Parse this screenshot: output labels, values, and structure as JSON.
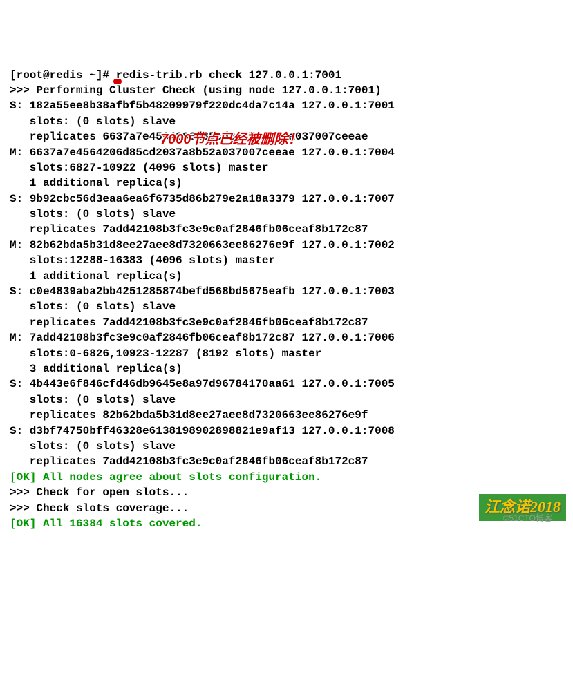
{
  "prompt_user": "root",
  "prompt_host": "redis",
  "prompt_path": "~",
  "prompt_symbol": "#",
  "command": "redis-trib.rb check 127.0.0.1:7001",
  "header": ">>> Performing Cluster Check (using node 127.0.0.1:7001)",
  "annotation_text": "7000节点已经被删除！",
  "nodes": [
    {
      "prefix": "S:",
      "id": "182a55ee8b38afbf5b48209979f220dc4da7c14a",
      "addr": "127.0.0.1:7001",
      "slots": "slots: (0 slots) slave",
      "extra": "replicates 6637a7e4564206d85cd2037a8b52a037007ceeae"
    },
    {
      "prefix": "M:",
      "id": "6637a7e4564206d85cd2037a8b52a037007ceeae",
      "addr": "127.0.0.1:7004",
      "slots": "slots:6827-10922 (4096 slots) master",
      "extra": "1 additional replica(s)"
    },
    {
      "prefix": "S:",
      "id": "9b92cbc56d3eaa6ea6f6735d86b279e2a18a3379",
      "addr": "127.0.0.1:7007",
      "slots": "slots: (0 slots) slave",
      "extra": "replicates 7add42108b3fc3e9c0af2846fb06ceaf8b172c87"
    },
    {
      "prefix": "M:",
      "id": "82b62bda5b31d8ee27aee8d7320663ee86276e9f",
      "addr": "127.0.0.1:7002",
      "slots": "slots:12288-16383 (4096 slots) master",
      "extra": "1 additional replica(s)"
    },
    {
      "prefix": "S:",
      "id": "c0e4839aba2bb4251285874befd568bd5675eafb",
      "addr": "127.0.0.1:7003",
      "slots": "slots: (0 slots) slave",
      "extra": "replicates 7add42108b3fc3e9c0af2846fb06ceaf8b172c87"
    },
    {
      "prefix": "M:",
      "id": "7add42108b3fc3e9c0af2846fb06ceaf8b172c87",
      "addr": "127.0.0.1:7006",
      "slots": "slots:0-6826,10923-12287 (8192 slots) master",
      "extra": "3 additional replica(s)"
    },
    {
      "prefix": "S:",
      "id": "4b443e6f846cfd46db9645e8a97d96784170aa61",
      "addr": "127.0.0.1:7005",
      "slots": "slots: (0 slots) slave",
      "extra": "replicates 82b62bda5b31d8ee27aee8d7320663ee86276e9f"
    },
    {
      "prefix": "S:",
      "id": "d3bf74750bff46328e6138198902898821e9af13",
      "addr": "127.0.0.1:7008",
      "slots": "slots: (0 slots) slave",
      "extra": "replicates 7add42108b3fc3e9c0af2846fb06ceaf8b172c87"
    }
  ],
  "ok1": "[OK] All nodes agree about slots configuration.",
  "check_open": ">>> Check for open slots...",
  "check_cov": ">>> Check slots coverage...",
  "ok2": "[OK] All 16384 slots covered.",
  "watermark1": "江念诺2018",
  "watermark2": "©51CTO博客"
}
